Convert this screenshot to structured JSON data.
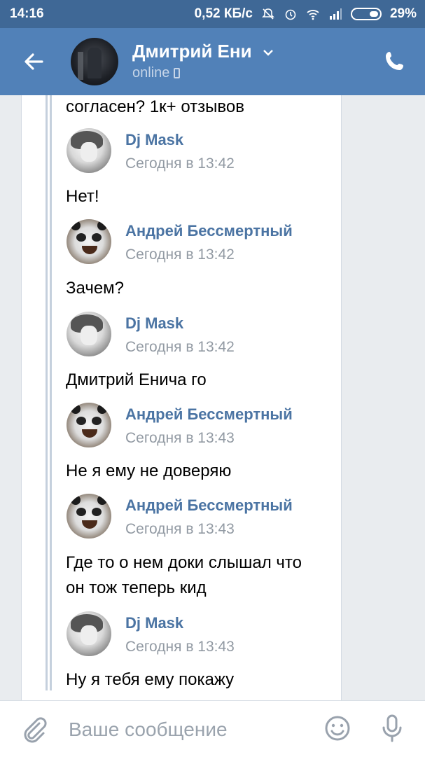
{
  "status_bar": {
    "time": "14:16",
    "speed": "0,52 КБ/с",
    "battery": "29%"
  },
  "header": {
    "title": "Дмитрий Ени",
    "status": "online"
  },
  "messages": [
    {
      "text": "согласен? 1к+ отзывов"
    },
    {
      "author": "Dj Mask",
      "date": "Сегодня в 13:42",
      "text": "Нет!"
    },
    {
      "author": "Андрей Бессмертный",
      "date": "Сегодня в 13:42",
      "text": "Зачем?"
    },
    {
      "author": "Dj Mask",
      "date": "Сегодня в 13:42",
      "text": "Дмитрий Енича го"
    },
    {
      "author": "Андрей Бессмертный",
      "date": "Сегодня в 13:43",
      "text": "Не я ему не доверяю"
    },
    {
      "author": "Андрей Бессмертный",
      "date": "Сегодня в 13:43",
      "text_line1": "Где то о нем доки слышал что",
      "text_line2": "он тож теперь кид"
    },
    {
      "author": "Dj Mask",
      "date": "Сегодня в 13:43",
      "text": "Ну я тебя ему покажу"
    }
  ],
  "composer": {
    "placeholder": "Ваше сообщение"
  },
  "colors": {
    "status_bar": "#3f6896",
    "header": "#5181b8",
    "author_link": "#4b74a3"
  }
}
